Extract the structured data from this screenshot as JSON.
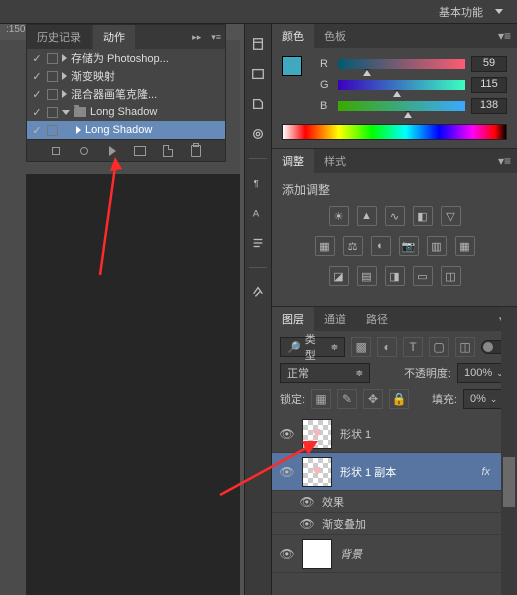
{
  "topbar": {
    "workspace": "基本功能"
  },
  "ruler": {
    "mark": ":150"
  },
  "actions_panel": {
    "tabs": {
      "history": "历史记录",
      "actions": "动作"
    },
    "items": [
      {
        "label": "存储为 Photoshop..."
      },
      {
        "label": "渐变映射"
      },
      {
        "label": "混合器画笔克隆..."
      },
      {
        "label": "Long Shadow"
      },
      {
        "label": "Long Shadow"
      }
    ]
  },
  "color_panel": {
    "tabs": {
      "color": "颜色",
      "swatches": "色板"
    },
    "channels": {
      "R": "R",
      "G": "G",
      "B": "B"
    },
    "values": {
      "R": "59",
      "G": "115",
      "B": "138"
    }
  },
  "adjustments_panel": {
    "tabs": {
      "adj": "调整",
      "styles": "样式"
    },
    "title": "添加调整"
  },
  "layers_panel": {
    "tabs": {
      "layers": "图层",
      "channels": "通道",
      "paths": "路径"
    },
    "filter_label": "类型",
    "blend_mode": "正常",
    "opacity_label": "不透明度:",
    "opacity_value": "100%",
    "lock_label": "锁定:",
    "fill_label": "填充:",
    "fill_value": "0%",
    "layers": [
      {
        "name": "形状 1"
      },
      {
        "name": "形状 1 副本",
        "fx": "fx"
      },
      {
        "name": "效果"
      },
      {
        "name": "渐变叠加"
      },
      {
        "name": "背景"
      }
    ]
  }
}
